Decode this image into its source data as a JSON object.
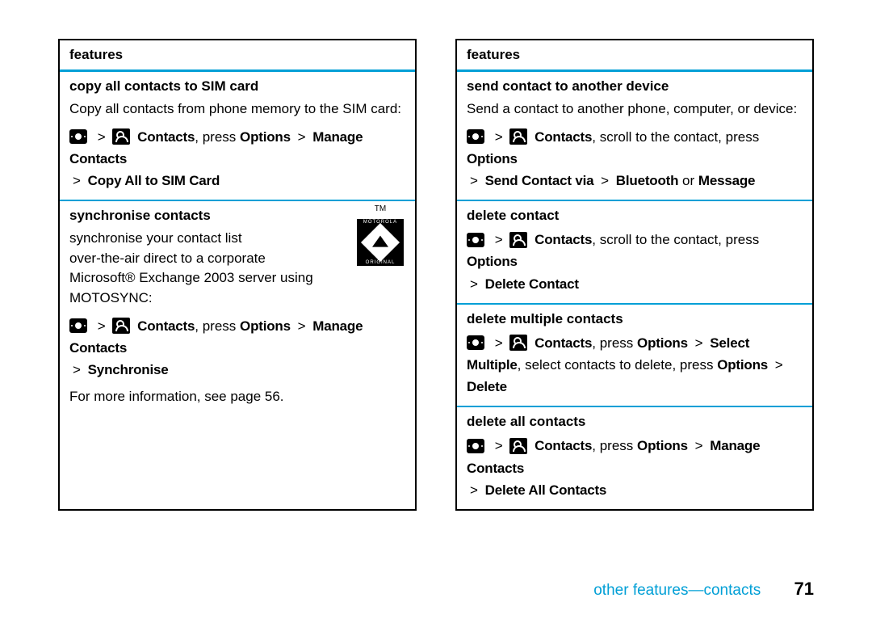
{
  "left": {
    "header": "features",
    "s1": {
      "title": "copy all contacts to SIM card",
      "desc": "Copy all contacts from phone memory to the SIM card:",
      "path_contacts": "Contacts",
      "path_press": ", press",
      "path_opts": "Options",
      "path_mc": "Manage Contacts",
      "path_end": "Copy All to SIM Card"
    },
    "s2": {
      "title": "synchronise contacts",
      "tm": "TM",
      "moto_top": "MOTOROLA",
      "moto_bot": "ORIGINAL",
      "desc1": "synchronise your contact list",
      "desc2": "over-the-air direct to a corporate",
      "desc3": "Microsoft® Exchange 2003 server using",
      "desc4": "MOTOSYNC:",
      "path_contacts": "Contacts",
      "path_press": ", press",
      "path_opts": "Options",
      "path_mc": "Manage Contacts",
      "path_end": "Synchronise",
      "footnote": "For more information, see page 56."
    }
  },
  "right": {
    "header": "features",
    "s1": {
      "title": "send contact to another device",
      "desc": "Send a contact to another phone, computer, or device:",
      "path_contacts": "Contacts",
      "path_scroll": ", scroll to the contact, press",
      "path_opts": "Options",
      "path_scv": "Send Contact via",
      "path_bt": "Bluetooth",
      "path_or": " or ",
      "path_msg": "Message"
    },
    "s2": {
      "title": "delete contact",
      "path_contacts": "Contacts",
      "path_scroll": ", scroll to the contact, press",
      "path_opts": "Options",
      "path_end": "Delete Contact"
    },
    "s3": {
      "title": "delete multiple contacts",
      "path_contacts": "Contacts",
      "path_press": ", press",
      "path_opts": "Options",
      "path_sm": "Select Multiple",
      "path_mid": ", select contacts to delete, press",
      "path_opts2": "Options",
      "path_del": "Delete"
    },
    "s4": {
      "title": "delete all contacts",
      "path_contacts": "Contacts",
      "path_press": ", press",
      "path_opts": "Options",
      "path_mc": "Manage Contacts",
      "path_end": "Delete All Contacts"
    }
  },
  "footer": {
    "section": "other features—contacts",
    "page": "71"
  }
}
